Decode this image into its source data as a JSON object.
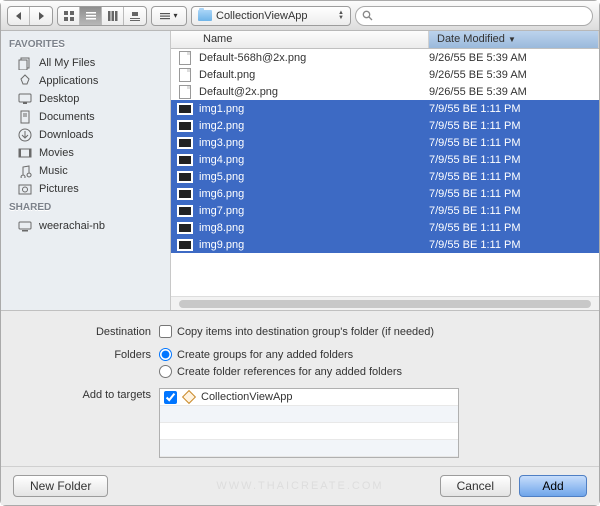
{
  "toolbar": {
    "path_label": "CollectionViewApp"
  },
  "sidebar": {
    "favorites_header": "FAVORITES",
    "shared_header": "SHARED",
    "favorites": [
      {
        "label": "All My Files",
        "icon": "all-files-icon"
      },
      {
        "label": "Applications",
        "icon": "applications-icon"
      },
      {
        "label": "Desktop",
        "icon": "desktop-icon"
      },
      {
        "label": "Documents",
        "icon": "documents-icon"
      },
      {
        "label": "Downloads",
        "icon": "downloads-icon"
      },
      {
        "label": "Movies",
        "icon": "movies-icon"
      },
      {
        "label": "Music",
        "icon": "music-icon"
      },
      {
        "label": "Pictures",
        "icon": "pictures-icon"
      }
    ],
    "shared": [
      {
        "label": "weerachai-nb",
        "icon": "computer-icon"
      }
    ]
  },
  "columns": {
    "name": "Name",
    "date": "Date Modified"
  },
  "files": [
    {
      "name": "Default-568h@2x.png",
      "date": "9/26/55 BE 5:39 AM",
      "selected": false,
      "kind": "file"
    },
    {
      "name": "Default.png",
      "date": "9/26/55 BE 5:39 AM",
      "selected": false,
      "kind": "file"
    },
    {
      "name": "Default@2x.png",
      "date": "9/26/55 BE 5:39 AM",
      "selected": false,
      "kind": "file"
    },
    {
      "name": "img1.png",
      "date": "7/9/55 BE 1:11 PM",
      "selected": true,
      "kind": "image"
    },
    {
      "name": "img2.png",
      "date": "7/9/55 BE 1:11 PM",
      "selected": true,
      "kind": "image"
    },
    {
      "name": "img3.png",
      "date": "7/9/55 BE 1:11 PM",
      "selected": true,
      "kind": "image"
    },
    {
      "name": "img4.png",
      "date": "7/9/55 BE 1:11 PM",
      "selected": true,
      "kind": "image"
    },
    {
      "name": "img5.png",
      "date": "7/9/55 BE 1:11 PM",
      "selected": true,
      "kind": "image"
    },
    {
      "name": "img6.png",
      "date": "7/9/55 BE 1:11 PM",
      "selected": true,
      "kind": "image"
    },
    {
      "name": "img7.png",
      "date": "7/9/55 BE 1:11 PM",
      "selected": true,
      "kind": "image"
    },
    {
      "name": "img8.png",
      "date": "7/9/55 BE 1:11 PM",
      "selected": true,
      "kind": "image"
    },
    {
      "name": "img9.png",
      "date": "7/9/55 BE 1:11 PM",
      "selected": true,
      "kind": "image"
    }
  ],
  "options": {
    "destination_label": "Destination",
    "copy_items_label": "Copy items into destination group's folder (if needed)",
    "copy_items_checked": false,
    "folders_label": "Folders",
    "create_groups_label": "Create groups for any added folders",
    "create_refs_label": "Create folder references for any added folders",
    "folders_choice": "groups",
    "targets_label": "Add to targets",
    "targets": [
      {
        "name": "CollectionViewApp",
        "checked": true
      }
    ]
  },
  "buttons": {
    "new_folder": "New Folder",
    "cancel": "Cancel",
    "add": "Add"
  },
  "watermark": "WWW.THAICREATE.COM"
}
